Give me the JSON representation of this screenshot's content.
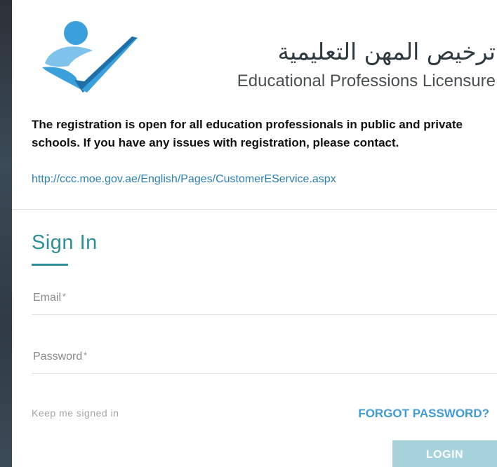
{
  "brand": {
    "arabic_name": "ترخيص المهن التعليمية",
    "english_name": "Educational Professions Licensure",
    "logo_icon": "person-checkmark-logo",
    "colors": {
      "logo_blue": "#3aa0dc",
      "logo_light_blue": "#7fc3ea",
      "logo_dark_blue": "#1f6fa8"
    }
  },
  "notice": {
    "text": "The registration is open for all education professionals in public and private schools. If you have any issues with registration, please contact.",
    "link": "http://ccc.moe.gov.ae/English/Pages/CustomerEService.aspx"
  },
  "signin": {
    "title": "Sign In",
    "email_label": "Email",
    "password_label": "Password",
    "required_mark": "*",
    "keep_signed_in": "Keep me signed in",
    "forgot_password": "FORGOT PASSWORD?",
    "login_button": "LOGIN"
  },
  "colors": {
    "accent_teal": "#2c8f9a",
    "link_blue": "#2a7fb0",
    "forgot_blue": "#3f9bd4",
    "login_button_bg": "#a6d2dc"
  }
}
